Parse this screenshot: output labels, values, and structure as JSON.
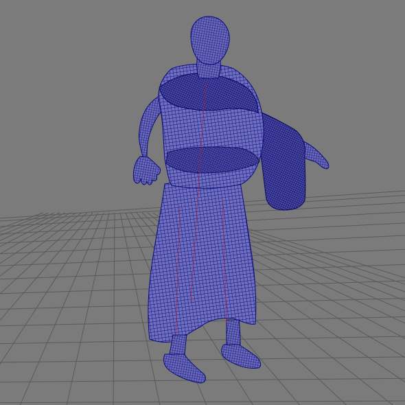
{
  "viewport": {
    "background_color": "#7b7b7b",
    "grid_line_color": "#5a5a5a",
    "grid_visible": true
  },
  "model": {
    "display_mode": "wireframe",
    "wire_color": "#0a0a78",
    "fill_color": "#6f6fc0",
    "seam_color": "#b0202a"
  }
}
